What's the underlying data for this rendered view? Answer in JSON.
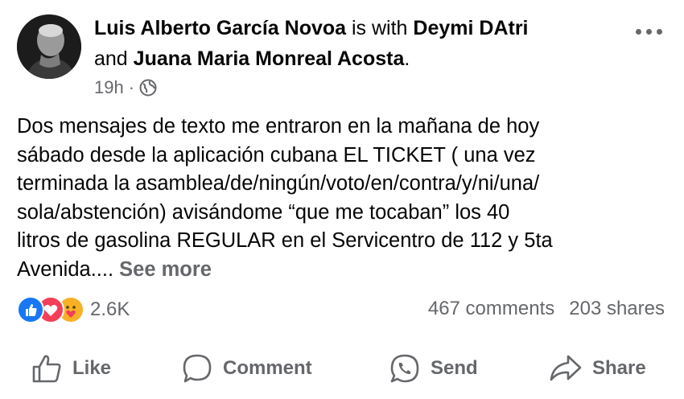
{
  "post": {
    "author": "Luis Alberto García Novoa",
    "with_text": " is with ",
    "tagged_1": "Deymi DAtri",
    "and_text": "and ",
    "tagged_2": "Juana Maria Monreal Acosta",
    "period": ".",
    "time": "19h",
    "separator": "·",
    "audience_icon": "globe-icon",
    "body_lines": [
      "Dos mensajes de texto me entraron en la mañana de hoy",
      "sábado desde la aplicación cubana EL TICKET ( una vez",
      "terminada la asamblea/de/ningún/voto/en/contra/y/ni/una/",
      "sola/abstención) avisándome “que me tocaban” los 40",
      "litros de gasolina REGULAR en el Servicentro de 112 y 5ta",
      "Avenida.... "
    ],
    "see_more": "See more"
  },
  "engagement": {
    "reaction_icons": [
      "like-reaction-icon",
      "love-reaction-icon",
      "care-reaction-icon"
    ],
    "reaction_count": "2.6K",
    "comments": "467 comments",
    "shares": "203 shares"
  },
  "actions": {
    "like": "Like",
    "comment": "Comment",
    "send": "Send",
    "share": "Share"
  },
  "colors": {
    "text": "#050505",
    "secondary": "#65676b",
    "like_blue": "#1877f2",
    "love_red": "#f33e58",
    "care_yellow": "#f7b125"
  }
}
